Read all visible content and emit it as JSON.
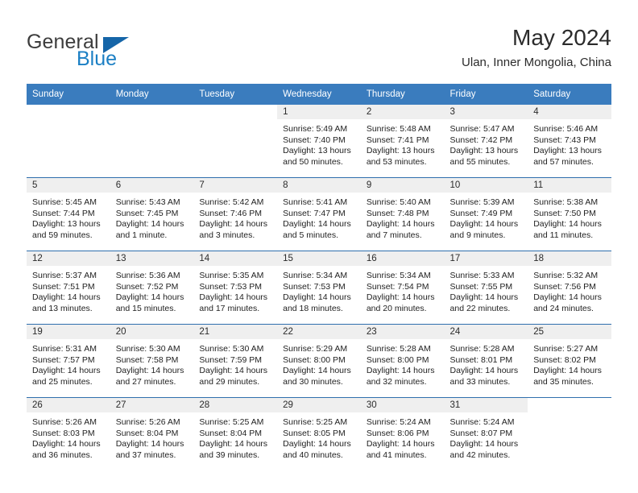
{
  "brand": {
    "name_part1": "General",
    "name_part2": "Blue",
    "triangle_color": "#1565a8",
    "blue_color": "#1b7fc4"
  },
  "header": {
    "month_title": "May 2024",
    "location": "Ulan, Inner Mongolia, China"
  },
  "calendar": {
    "header_color": "#3a7cbe",
    "week_separator_color": "#2f6fae",
    "daynum_band_color": "#efefef",
    "weekday_labels": [
      "Sunday",
      "Monday",
      "Tuesday",
      "Wednesday",
      "Thursday",
      "Friday",
      "Saturday"
    ],
    "weeks": [
      [
        {
          "day": "",
          "blank": true,
          "sunrise": "",
          "sunset": "",
          "daylight_1": "",
          "daylight_2": ""
        },
        {
          "day": "",
          "blank": true,
          "sunrise": "",
          "sunset": "",
          "daylight_1": "",
          "daylight_2": ""
        },
        {
          "day": "",
          "blank": true,
          "sunrise": "",
          "sunset": "",
          "daylight_1": "",
          "daylight_2": ""
        },
        {
          "day": "1",
          "sunrise": "Sunrise: 5:49 AM",
          "sunset": "Sunset: 7:40 PM",
          "daylight_1": "Daylight: 13 hours",
          "daylight_2": "and 50 minutes."
        },
        {
          "day": "2",
          "sunrise": "Sunrise: 5:48 AM",
          "sunset": "Sunset: 7:41 PM",
          "daylight_1": "Daylight: 13 hours",
          "daylight_2": "and 53 minutes."
        },
        {
          "day": "3",
          "sunrise": "Sunrise: 5:47 AM",
          "sunset": "Sunset: 7:42 PM",
          "daylight_1": "Daylight: 13 hours",
          "daylight_2": "and 55 minutes."
        },
        {
          "day": "4",
          "sunrise": "Sunrise: 5:46 AM",
          "sunset": "Sunset: 7:43 PM",
          "daylight_1": "Daylight: 13 hours",
          "daylight_2": "and 57 minutes."
        }
      ],
      [
        {
          "day": "5",
          "sunrise": "Sunrise: 5:45 AM",
          "sunset": "Sunset: 7:44 PM",
          "daylight_1": "Daylight: 13 hours",
          "daylight_2": "and 59 minutes."
        },
        {
          "day": "6",
          "sunrise": "Sunrise: 5:43 AM",
          "sunset": "Sunset: 7:45 PM",
          "daylight_1": "Daylight: 14 hours",
          "daylight_2": "and 1 minute."
        },
        {
          "day": "7",
          "sunrise": "Sunrise: 5:42 AM",
          "sunset": "Sunset: 7:46 PM",
          "daylight_1": "Daylight: 14 hours",
          "daylight_2": "and 3 minutes."
        },
        {
          "day": "8",
          "sunrise": "Sunrise: 5:41 AM",
          "sunset": "Sunset: 7:47 PM",
          "daylight_1": "Daylight: 14 hours",
          "daylight_2": "and 5 minutes."
        },
        {
          "day": "9",
          "sunrise": "Sunrise: 5:40 AM",
          "sunset": "Sunset: 7:48 PM",
          "daylight_1": "Daylight: 14 hours",
          "daylight_2": "and 7 minutes."
        },
        {
          "day": "10",
          "sunrise": "Sunrise: 5:39 AM",
          "sunset": "Sunset: 7:49 PM",
          "daylight_1": "Daylight: 14 hours",
          "daylight_2": "and 9 minutes."
        },
        {
          "day": "11",
          "sunrise": "Sunrise: 5:38 AM",
          "sunset": "Sunset: 7:50 PM",
          "daylight_1": "Daylight: 14 hours",
          "daylight_2": "and 11 minutes."
        }
      ],
      [
        {
          "day": "12",
          "sunrise": "Sunrise: 5:37 AM",
          "sunset": "Sunset: 7:51 PM",
          "daylight_1": "Daylight: 14 hours",
          "daylight_2": "and 13 minutes."
        },
        {
          "day": "13",
          "sunrise": "Sunrise: 5:36 AM",
          "sunset": "Sunset: 7:52 PM",
          "daylight_1": "Daylight: 14 hours",
          "daylight_2": "and 15 minutes."
        },
        {
          "day": "14",
          "sunrise": "Sunrise: 5:35 AM",
          "sunset": "Sunset: 7:53 PM",
          "daylight_1": "Daylight: 14 hours",
          "daylight_2": "and 17 minutes."
        },
        {
          "day": "15",
          "sunrise": "Sunrise: 5:34 AM",
          "sunset": "Sunset: 7:53 PM",
          "daylight_1": "Daylight: 14 hours",
          "daylight_2": "and 18 minutes."
        },
        {
          "day": "16",
          "sunrise": "Sunrise: 5:34 AM",
          "sunset": "Sunset: 7:54 PM",
          "daylight_1": "Daylight: 14 hours",
          "daylight_2": "and 20 minutes."
        },
        {
          "day": "17",
          "sunrise": "Sunrise: 5:33 AM",
          "sunset": "Sunset: 7:55 PM",
          "daylight_1": "Daylight: 14 hours",
          "daylight_2": "and 22 minutes."
        },
        {
          "day": "18",
          "sunrise": "Sunrise: 5:32 AM",
          "sunset": "Sunset: 7:56 PM",
          "daylight_1": "Daylight: 14 hours",
          "daylight_2": "and 24 minutes."
        }
      ],
      [
        {
          "day": "19",
          "sunrise": "Sunrise: 5:31 AM",
          "sunset": "Sunset: 7:57 PM",
          "daylight_1": "Daylight: 14 hours",
          "daylight_2": "and 25 minutes."
        },
        {
          "day": "20",
          "sunrise": "Sunrise: 5:30 AM",
          "sunset": "Sunset: 7:58 PM",
          "daylight_1": "Daylight: 14 hours",
          "daylight_2": "and 27 minutes."
        },
        {
          "day": "21",
          "sunrise": "Sunrise: 5:30 AM",
          "sunset": "Sunset: 7:59 PM",
          "daylight_1": "Daylight: 14 hours",
          "daylight_2": "and 29 minutes."
        },
        {
          "day": "22",
          "sunrise": "Sunrise: 5:29 AM",
          "sunset": "Sunset: 8:00 PM",
          "daylight_1": "Daylight: 14 hours",
          "daylight_2": "and 30 minutes."
        },
        {
          "day": "23",
          "sunrise": "Sunrise: 5:28 AM",
          "sunset": "Sunset: 8:00 PM",
          "daylight_1": "Daylight: 14 hours",
          "daylight_2": "and 32 minutes."
        },
        {
          "day": "24",
          "sunrise": "Sunrise: 5:28 AM",
          "sunset": "Sunset: 8:01 PM",
          "daylight_1": "Daylight: 14 hours",
          "daylight_2": "and 33 minutes."
        },
        {
          "day": "25",
          "sunrise": "Sunrise: 5:27 AM",
          "sunset": "Sunset: 8:02 PM",
          "daylight_1": "Daylight: 14 hours",
          "daylight_2": "and 35 minutes."
        }
      ],
      [
        {
          "day": "26",
          "sunrise": "Sunrise: 5:26 AM",
          "sunset": "Sunset: 8:03 PM",
          "daylight_1": "Daylight: 14 hours",
          "daylight_2": "and 36 minutes."
        },
        {
          "day": "27",
          "sunrise": "Sunrise: 5:26 AM",
          "sunset": "Sunset: 8:04 PM",
          "daylight_1": "Daylight: 14 hours",
          "daylight_2": "and 37 minutes."
        },
        {
          "day": "28",
          "sunrise": "Sunrise: 5:25 AM",
          "sunset": "Sunset: 8:04 PM",
          "daylight_1": "Daylight: 14 hours",
          "daylight_2": "and 39 minutes."
        },
        {
          "day": "29",
          "sunrise": "Sunrise: 5:25 AM",
          "sunset": "Sunset: 8:05 PM",
          "daylight_1": "Daylight: 14 hours",
          "daylight_2": "and 40 minutes."
        },
        {
          "day": "30",
          "sunrise": "Sunrise: 5:24 AM",
          "sunset": "Sunset: 8:06 PM",
          "daylight_1": "Daylight: 14 hours",
          "daylight_2": "and 41 minutes."
        },
        {
          "day": "31",
          "sunrise": "Sunrise: 5:24 AM",
          "sunset": "Sunset: 8:07 PM",
          "daylight_1": "Daylight: 14 hours",
          "daylight_2": "and 42 minutes."
        },
        {
          "day": "",
          "blank": true,
          "sunrise": "",
          "sunset": "",
          "daylight_1": "",
          "daylight_2": ""
        }
      ]
    ]
  }
}
